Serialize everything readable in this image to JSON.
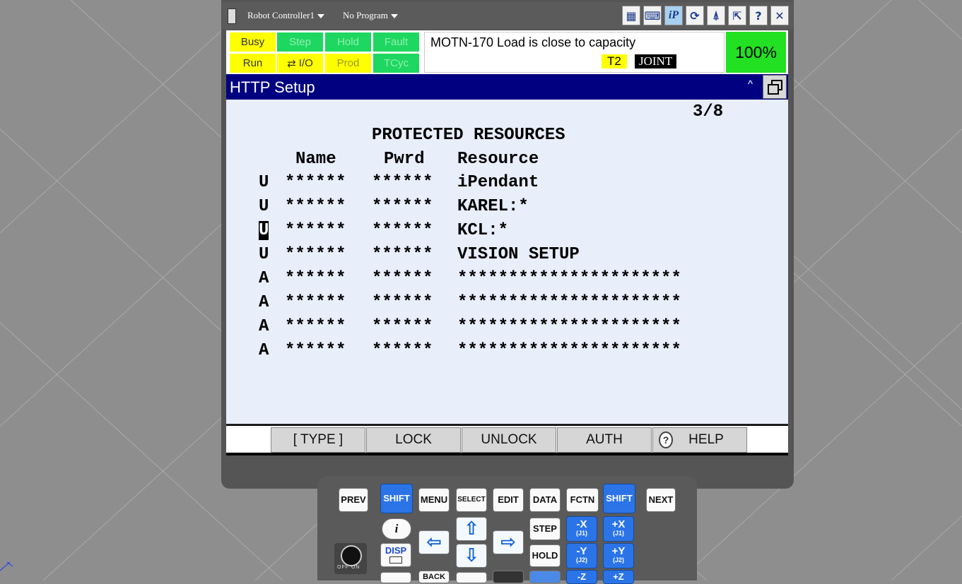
{
  "title_bar": {
    "controller_label": "Robot Controller1",
    "program_label": "No Program",
    "buttons": [
      {
        "name": "pendant-icon",
        "glyph": "▦"
      },
      {
        "name": "keyboard-icon",
        "glyph": "⌨"
      },
      {
        "name": "ip-icon",
        "glyph": "iP"
      },
      {
        "name": "refresh-icon",
        "glyph": "⟳"
      },
      {
        "name": "antenna-icon",
        "glyph": "⍋"
      },
      {
        "name": "pop-out-icon",
        "glyph": "⇱"
      },
      {
        "name": "help-circle-icon",
        "glyph": "?"
      },
      {
        "name": "close-icon",
        "glyph": "✕"
      }
    ]
  },
  "status": {
    "leds_top": [
      "Busy",
      "Step",
      "Hold",
      "Fault"
    ],
    "leds_bottom": [
      "Run",
      "I/O",
      "Prod",
      "TCyc"
    ],
    "alarm": "MOTN-170 Load is close to capacity",
    "mode": "T2",
    "coord": "JOINT",
    "override": "100%",
    "colors": {
      "yellow": "#ffff00",
      "green": "#1ed760",
      "override": "#22e022"
    }
  },
  "screen": {
    "title": "HTTP Setup",
    "page": "3/8",
    "heading": "PROTECTED RESOURCES",
    "columns": {
      "name": "Name",
      "pwrd": "Pwrd",
      "resource": "Resource"
    },
    "rows": [
      {
        "type": "U",
        "name": "******",
        "pwrd": "******",
        "resource": "iPendant"
      },
      {
        "type": "U",
        "name": "******",
        "pwrd": "******",
        "resource": "KAREL:*"
      },
      {
        "type": "U",
        "name": "******",
        "pwrd": "******",
        "resource": "KCL:*",
        "selected": true
      },
      {
        "type": "U",
        "name": "******",
        "pwrd": "******",
        "resource": "VISION SETUP"
      },
      {
        "type": "A",
        "name": "******",
        "pwrd": "******",
        "resource": "**********************"
      },
      {
        "type": "A",
        "name": "******",
        "pwrd": "******",
        "resource": "**********************"
      },
      {
        "type": "A",
        "name": "******",
        "pwrd": "******",
        "resource": "**********************"
      },
      {
        "type": "A",
        "name": "******",
        "pwrd": "******",
        "resource": "**********************"
      }
    ]
  },
  "function_keys": {
    "f1": "[ TYPE ]",
    "f2": "LOCK",
    "f3": "UNLOCK",
    "f4": "AUTH",
    "f5": "HELP"
  },
  "keypad": {
    "prev": "PREV",
    "shift": "SHIFT",
    "menu": "MENU",
    "select": "SELECT",
    "edit": "EDIT",
    "data": "DATA",
    "fctn": "FCTN",
    "next": "NEXT",
    "info": "i",
    "disp": "DISP",
    "step": "STEP",
    "hold": "HOLD",
    "back": "BACK",
    "mx": "-X",
    "mx_sub": "(J1)",
    "px": "+X",
    "px_sub": "(J1)",
    "my": "-Y",
    "my_sub": "(J2)",
    "py": "+Y",
    "py_sub": "(J2)",
    "mz": "-Z",
    "pz": "+Z",
    "keyswitch_label": "OFF  ON"
  }
}
